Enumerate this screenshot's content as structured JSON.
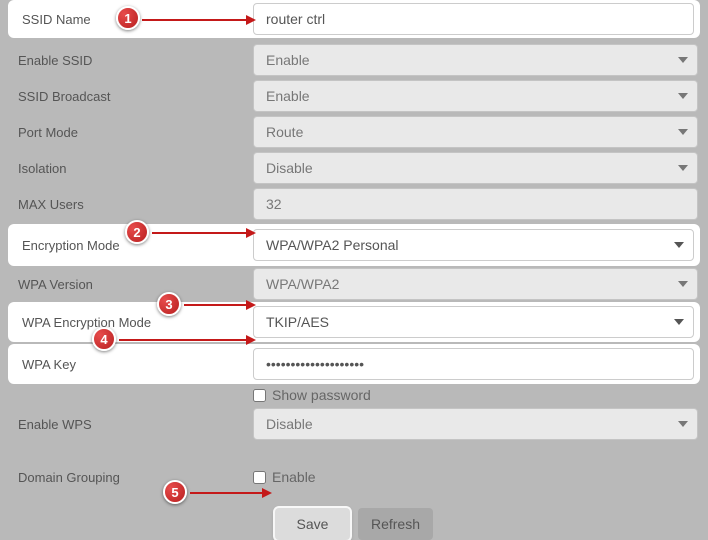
{
  "step_markers": [
    "1",
    "2",
    "3",
    "4",
    "5"
  ],
  "fields": {
    "ssid_name": {
      "label": "SSID Name",
      "value": "router ctrl"
    },
    "enable_ssid": {
      "label": "Enable SSID",
      "value": "Enable"
    },
    "ssid_broadcast": {
      "label": "SSID Broadcast",
      "value": "Enable"
    },
    "port_mode": {
      "label": "Port Mode",
      "value": "Route"
    },
    "isolation": {
      "label": "Isolation",
      "value": "Disable"
    },
    "max_users": {
      "label": "MAX Users",
      "value": "32"
    },
    "encryption_mode": {
      "label": "Encryption Mode",
      "value": "WPA/WPA2 Personal"
    },
    "wpa_version": {
      "label": "WPA Version",
      "value": "WPA/WPA2"
    },
    "wpa_enc_mode": {
      "label": "WPA Encryption Mode",
      "value": "TKIP/AES"
    },
    "wpa_key": {
      "label": "WPA Key",
      "value": "••••••••••••••••••••"
    },
    "show_password": {
      "label": "Show password"
    },
    "enable_wps": {
      "label": "Enable WPS",
      "value": "Disable"
    },
    "domain_grouping": {
      "label": "Domain Grouping",
      "checkbox_label": "Enable"
    }
  },
  "buttons": {
    "save": "Save",
    "refresh": "Refresh"
  }
}
